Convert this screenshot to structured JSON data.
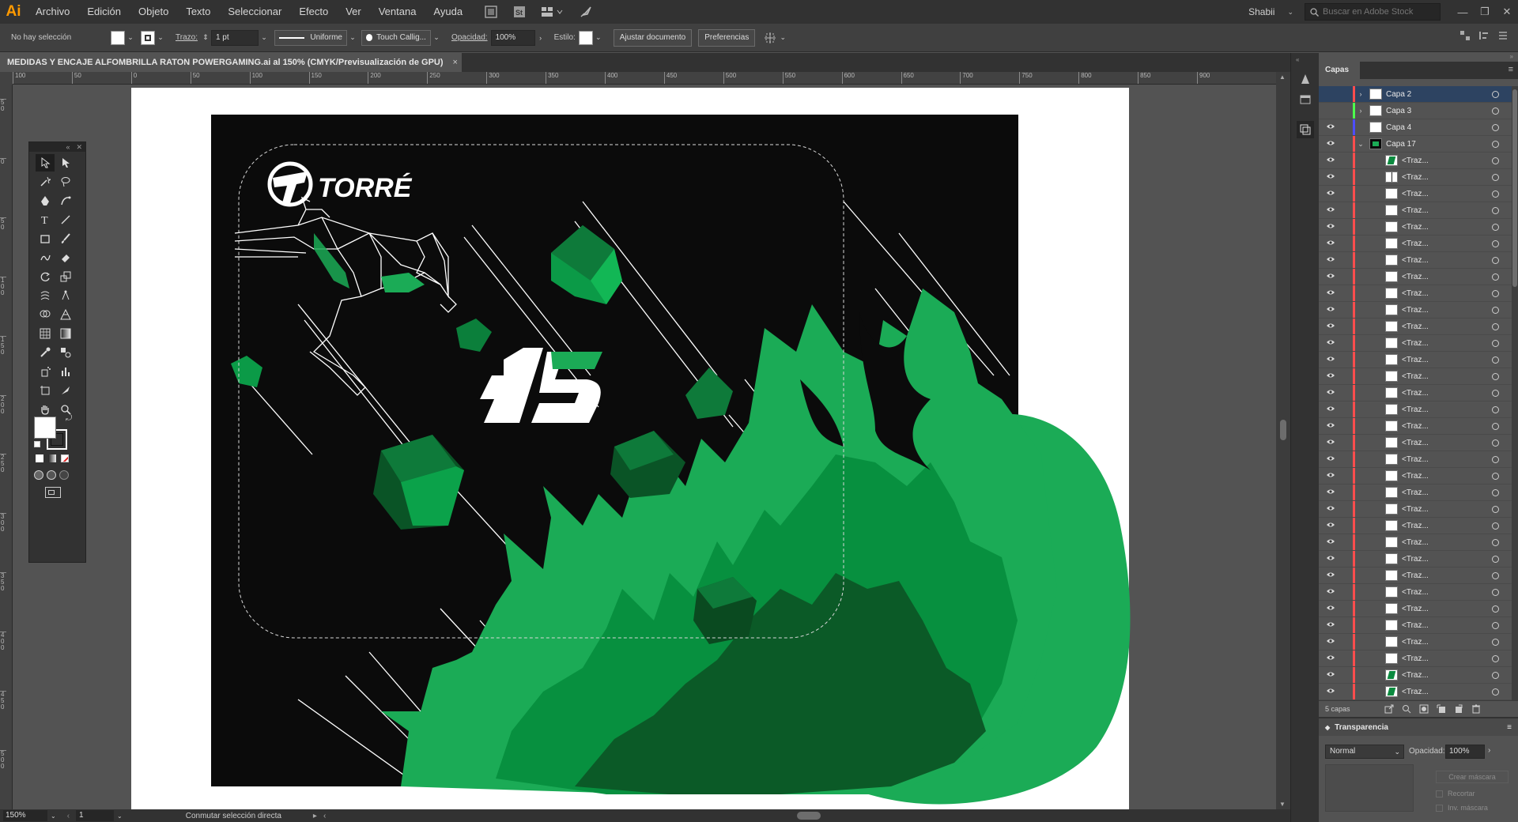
{
  "app": {
    "logo": "Ai"
  },
  "menu": [
    "Archivo",
    "Edición",
    "Objeto",
    "Texto",
    "Seleccionar",
    "Efecto",
    "Ver",
    "Ventana",
    "Ayuda"
  ],
  "menubar_right": {
    "user": "Shabii",
    "search_placeholder": "Buscar en Adobe Stock"
  },
  "control": {
    "selection": "No hay selección",
    "stroke_label": "Trazo:",
    "stroke_weight": "1 pt",
    "stroke_profile": "Uniforme",
    "brush": "Touch Callig...",
    "opacity_label": "Opacidad:",
    "opacity": "100%",
    "style_label": "Estilo:",
    "fit_button": "Ajustar documento",
    "prefs_button": "Preferencias"
  },
  "document": {
    "tab_title": "MEDIDAS Y ENCAJE ALFOMBRILLA RATON POWERGAMING.ai al 150% (CMYK/Previsualización de GPU)",
    "close": "×"
  },
  "ruler": {
    "h": [
      {
        "label": "100",
        "pos": 0
      },
      {
        "label": "50",
        "pos": 1
      },
      {
        "label": "0",
        "pos": 2
      },
      {
        "label": "50",
        "pos": 3
      },
      {
        "label": "100",
        "pos": 4
      },
      {
        "label": "150",
        "pos": 5
      },
      {
        "label": "200",
        "pos": 6
      },
      {
        "label": "250",
        "pos": 7
      },
      {
        "label": "300",
        "pos": 8
      },
      {
        "label": "350",
        "pos": 9
      },
      {
        "label": "400",
        "pos": 10
      },
      {
        "label": "450",
        "pos": 11
      },
      {
        "label": "500",
        "pos": 12
      },
      {
        "label": "550",
        "pos": 13
      },
      {
        "label": "600",
        "pos": 14
      },
      {
        "label": "650",
        "pos": 15
      },
      {
        "label": "700",
        "pos": 16
      },
      {
        "label": "750",
        "pos": 17
      },
      {
        "label": "800",
        "pos": 18
      },
      {
        "label": "850",
        "pos": 19
      },
      {
        "label": "900",
        "pos": 20
      }
    ],
    "v": [
      "50",
      "0",
      "50",
      "100",
      "150",
      "200",
      "250",
      "300",
      "350",
      "400",
      "450",
      "500",
      "550"
    ]
  },
  "artwork": {
    "brand": "TORRÉ",
    "number": "15",
    "colors": {
      "bg": "#0b0b0b",
      "green_light": "#1bab56",
      "green_mid": "#07903f",
      "green_dark": "#0b5a27",
      "green_deep": "#0a4a20",
      "cube_top": "#0e7a3a",
      "cube_side": "#0ba24a",
      "cube_front": "#0a5426"
    }
  },
  "status": {
    "zoom": "150%",
    "artboard": "1",
    "tool_hint": "Conmutar selección directa"
  },
  "panels": {
    "layers": {
      "tab": "Capas",
      "count": "5 capas",
      "rows": [
        {
          "name": "Capa 2",
          "color": "#ff4d4d",
          "expand": "›",
          "sel": true,
          "eye": ""
        },
        {
          "name": "Capa 3",
          "color": "#4dff4d",
          "expand": "›",
          "sel": false,
          "eye": ""
        },
        {
          "name": "Capa 4",
          "color": "#4d4dff",
          "expand": "",
          "sel": false,
          "eye": "👁"
        },
        {
          "name": "Capa 17",
          "color": "#ff4d4d",
          "expand": "⌄",
          "sel": false,
          "eye": "👁",
          "thumb": "dark"
        },
        {
          "name": "<Traz...",
          "color": "#ff4d4d",
          "sub": true,
          "thumb": "green"
        },
        {
          "name": "<Traz...",
          "color": "#ff4d4d",
          "sub": true,
          "thumb": "line"
        },
        {
          "name": "<Traz...",
          "color": "#ff4d4d",
          "sub": true
        },
        {
          "name": "<Traz...",
          "color": "#ff4d4d",
          "sub": true
        },
        {
          "name": "<Traz...",
          "color": "#ff4d4d",
          "sub": true
        },
        {
          "name": "<Traz...",
          "color": "#ff4d4d",
          "sub": true
        },
        {
          "name": "<Traz...",
          "color": "#ff4d4d",
          "sub": true
        },
        {
          "name": "<Traz...",
          "color": "#ff4d4d",
          "sub": true
        },
        {
          "name": "<Traz...",
          "color": "#ff4d4d",
          "sub": true
        },
        {
          "name": "<Traz...",
          "color": "#ff4d4d",
          "sub": true
        },
        {
          "name": "<Traz...",
          "color": "#ff4d4d",
          "sub": true
        },
        {
          "name": "<Traz...",
          "color": "#ff4d4d",
          "sub": true
        },
        {
          "name": "<Traz...",
          "color": "#ff4d4d",
          "sub": true
        },
        {
          "name": "<Traz...",
          "color": "#ff4d4d",
          "sub": true
        },
        {
          "name": "<Traz...",
          "color": "#ff4d4d",
          "sub": true
        },
        {
          "name": "<Traz...",
          "color": "#ff4d4d",
          "sub": true
        },
        {
          "name": "<Traz...",
          "color": "#ff4d4d",
          "sub": true
        },
        {
          "name": "<Traz...",
          "color": "#ff4d4d",
          "sub": true
        },
        {
          "name": "<Traz...",
          "color": "#ff4d4d",
          "sub": true
        },
        {
          "name": "<Traz...",
          "color": "#ff4d4d",
          "sub": true
        },
        {
          "name": "<Traz...",
          "color": "#ff4d4d",
          "sub": true
        },
        {
          "name": "<Traz...",
          "color": "#ff4d4d",
          "sub": true
        },
        {
          "name": "<Traz...",
          "color": "#ff4d4d",
          "sub": true
        },
        {
          "name": "<Traz...",
          "color": "#ff4d4d",
          "sub": true
        },
        {
          "name": "<Traz...",
          "color": "#ff4d4d",
          "sub": true
        },
        {
          "name": "<Traz...",
          "color": "#ff4d4d",
          "sub": true
        },
        {
          "name": "<Traz...",
          "color": "#ff4d4d",
          "sub": true
        },
        {
          "name": "<Traz...",
          "color": "#ff4d4d",
          "sub": true
        },
        {
          "name": "<Traz...",
          "color": "#ff4d4d",
          "sub": true
        },
        {
          "name": "<Traz...",
          "color": "#ff4d4d",
          "sub": true
        },
        {
          "name": "<Traz...",
          "color": "#ff4d4d",
          "sub": true
        },
        {
          "name": "<Traz...",
          "color": "#ff4d4d",
          "sub": true,
          "thumb": "green"
        },
        {
          "name": "<Traz...",
          "color": "#ff4d4d",
          "sub": true,
          "thumb": "green"
        },
        {
          "name": "<Traz...",
          "color": "#ff4d4d",
          "sub": true
        },
        {
          "name": "<Traz...",
          "color": "#ff4d4d",
          "sub": true
        },
        {
          "name": "<Traz...",
          "color": "#ff4d4d",
          "sub": true
        },
        {
          "name": "<Traz...",
          "color": "#ff4d4d",
          "sub": true
        },
        {
          "name": "<Traz...",
          "color": "#ff4d4d",
          "sub": true
        },
        {
          "name": "<Traz...",
          "color": "#ff4d4d",
          "sub": true
        },
        {
          "name": "<Traz...",
          "color": "#ff4d4d",
          "sub": true
        },
        {
          "name": "<Traz...",
          "color": "#ff4d4d",
          "sub": true
        }
      ]
    },
    "transparency": {
      "title": "Transparencia",
      "blend": "Normal",
      "opacity_label": "Opacidad:",
      "opacity": "100%",
      "mask_button": "Crear máscara",
      "clip": "Recortar",
      "invert": "Inv. máscara"
    }
  }
}
